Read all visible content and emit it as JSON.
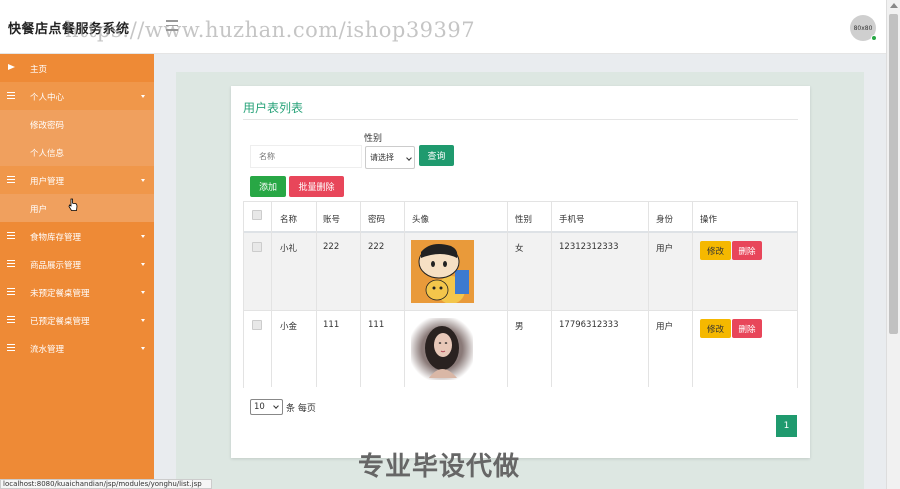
{
  "header": {
    "app_title": "快餐店点餐服务系统",
    "watermark": "https://www.huzhan.com/ishop39397",
    "avatar_text": "80x80"
  },
  "sidebar": {
    "items": [
      {
        "label": "主页",
        "icon": "flag-icon"
      },
      {
        "label": "个人中心",
        "icon": "grid-icon",
        "expanded": true
      },
      {
        "label": "修改密码",
        "sub": true
      },
      {
        "label": "个人信息",
        "sub": true
      },
      {
        "label": "用户管理",
        "icon": "grid-icon",
        "expanded": true
      },
      {
        "label": "用户",
        "sub": true
      },
      {
        "label": "食物库存管理",
        "icon": "grid-icon"
      },
      {
        "label": "商品展示管理",
        "icon": "grid-icon"
      },
      {
        "label": "未预定餐桌管理",
        "icon": "grid-icon"
      },
      {
        "label": "已预定餐桌管理",
        "icon": "grid-icon"
      },
      {
        "label": "流水管理",
        "icon": "grid-icon"
      }
    ]
  },
  "main": {
    "title": "用户表列表",
    "search": {
      "name_placeholder": "名称",
      "gender_label": "性别",
      "gender_selected": "请选择",
      "query_label": "查询"
    },
    "actions": {
      "add_label": "添加",
      "batch_delete_label": "批量删除"
    },
    "table": {
      "headers": [
        "名称",
        "账号",
        "密码",
        "头像",
        "性别",
        "手机号",
        "身份",
        "操作"
      ],
      "rows": [
        {
          "name": "小礼",
          "account": "222",
          "password": "222",
          "avatar": "cartoon-boy-photo",
          "gender": "女",
          "phone": "12312312333",
          "role": "用户"
        },
        {
          "name": "小金",
          "account": "111",
          "password": "111",
          "avatar": "woman-portrait-photo",
          "gender": "男",
          "phone": "17796312333",
          "role": "用户"
        }
      ],
      "edit_label": "修改",
      "delete_label": "删除"
    },
    "pagination": {
      "page_size": "10",
      "per_page_label": "条 每页",
      "current_page": "1"
    }
  },
  "overlay_caption": "专业毕设代做",
  "status_bar": "localhost:8080/kuaichandian/jsp/modules/yonghu/list.jsp",
  "colors": {
    "sidebar": "#ee8a36",
    "accent": "#29a37a",
    "danger": "#e8465a",
    "warning": "#f5b800",
    "success": "#28a745"
  }
}
